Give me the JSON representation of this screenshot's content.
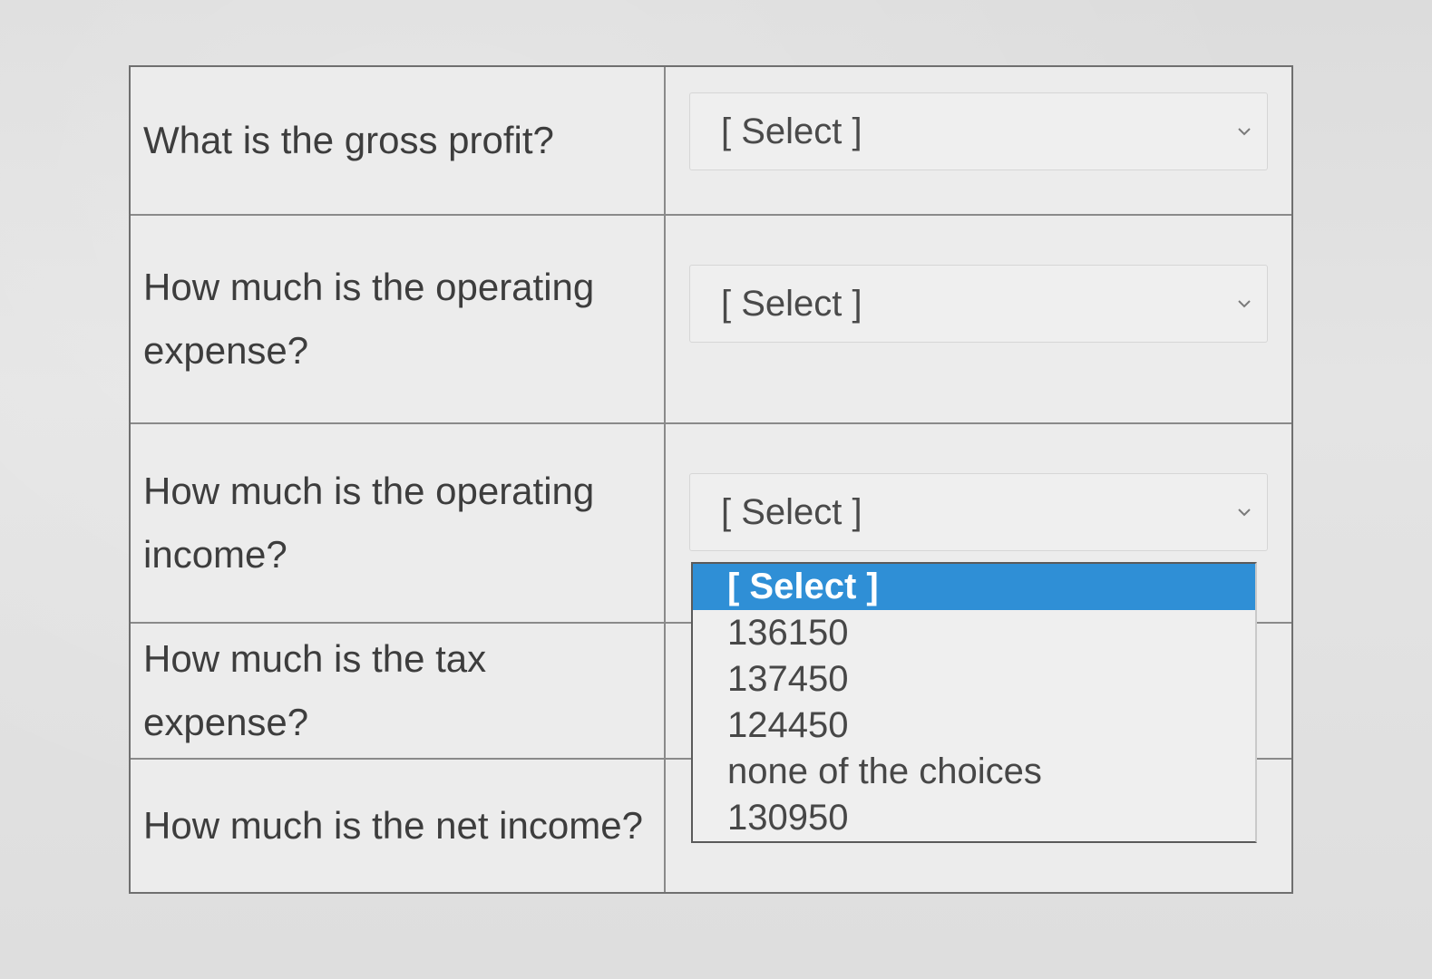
{
  "rows": [
    {
      "question": "What is the gross profit?",
      "selected": "[ Select ]"
    },
    {
      "question": "How much is the operating expense?",
      "selected": "[ Select ]"
    },
    {
      "question": "How much is the operating income?",
      "selected": "[ Select ]"
    },
    {
      "question": "How much is the tax expense?",
      "selected": ""
    },
    {
      "question": "How much is the net income?",
      "selected": ""
    }
  ],
  "dropdown": {
    "open_for_row": 3,
    "highlighted_option": "[ Select ]",
    "options": [
      "[ Select ]",
      "136150",
      "137450",
      "124450",
      "none of the choices",
      "130950"
    ]
  },
  "icons": {
    "select_arrow": "chevron-down-icon"
  },
  "colors": {
    "highlight": "#2f8fd6",
    "highlight_text": "#ffffff",
    "background": "#e2e2e2"
  }
}
